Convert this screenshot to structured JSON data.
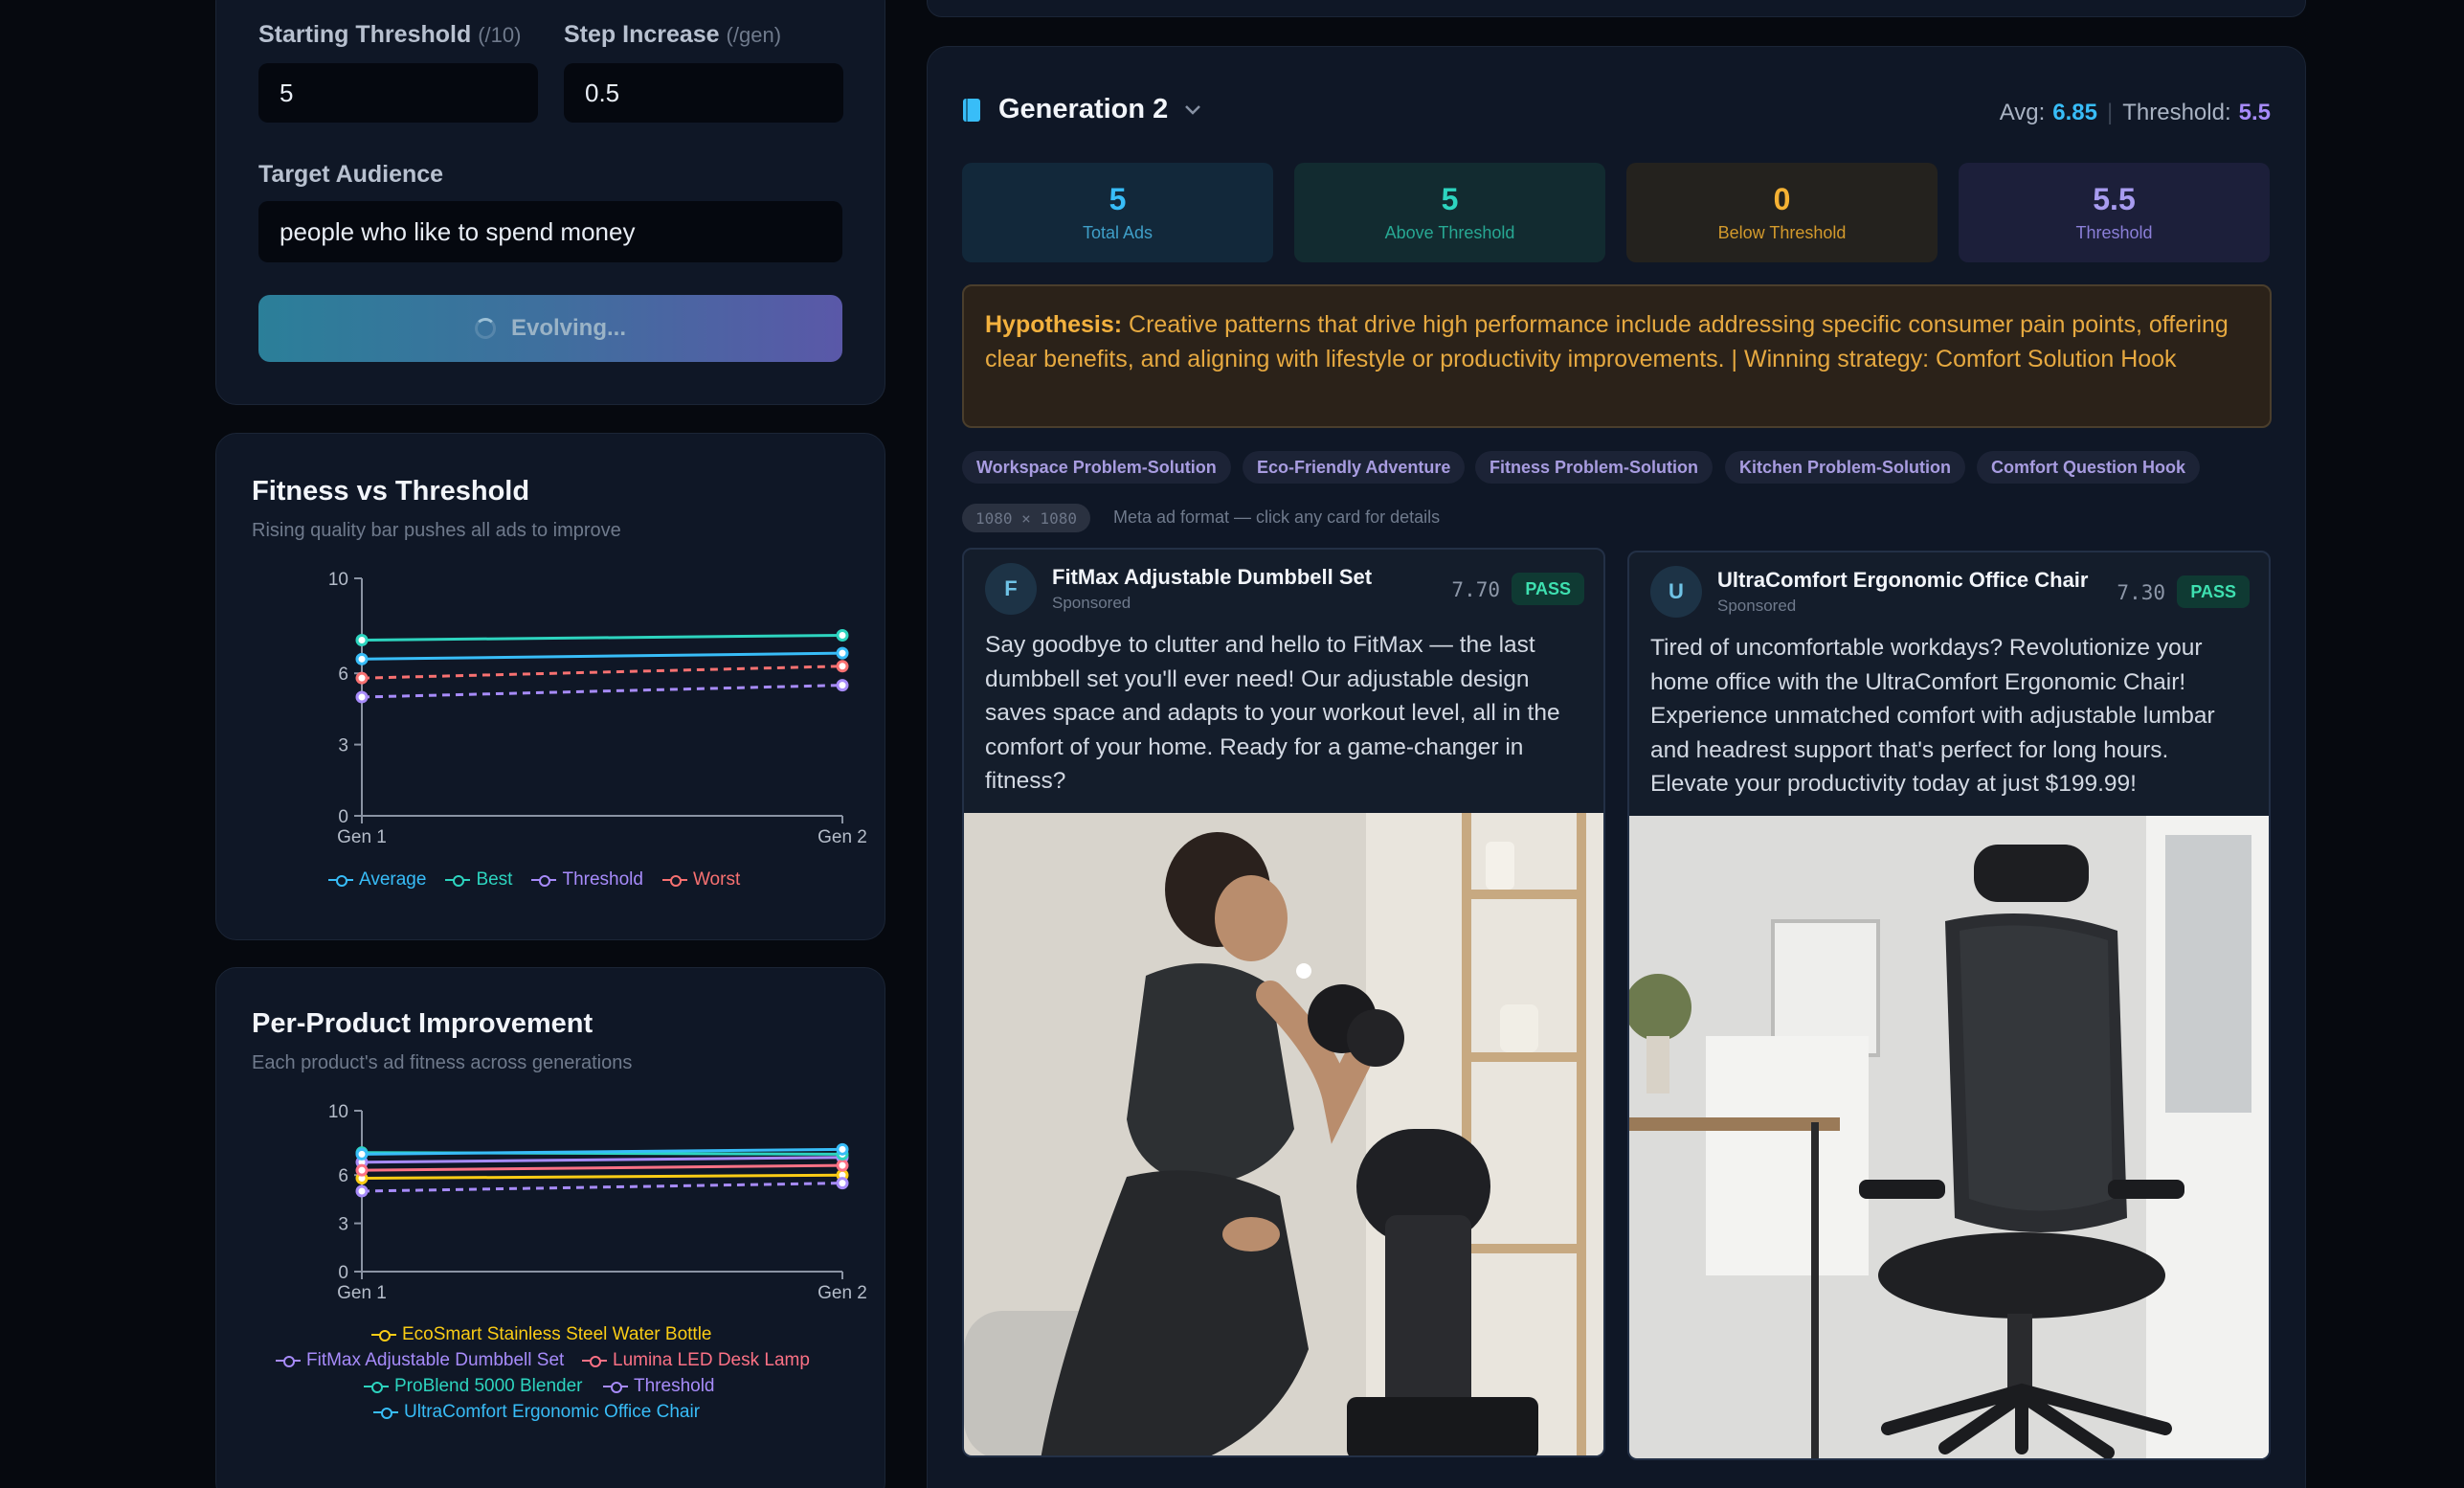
{
  "settings": {
    "starting_threshold_label": "Starting Threshold",
    "starting_threshold_unit": "(/10)",
    "starting_threshold_value": "5",
    "step_increase_label": "Step Increase",
    "step_increase_unit": "(/gen)",
    "step_increase_value": "0.5",
    "target_audience_label": "Target Audience",
    "target_audience_value": "people who like to spend money",
    "evolve_button_label": "Evolving..."
  },
  "fitness_chart": {
    "title": "Fitness vs Threshold",
    "subtitle": "Rising quality bar pushes all ads to improve",
    "legend": [
      "Average",
      "Best",
      "Threshold",
      "Worst"
    ]
  },
  "product_chart": {
    "title": "Per-Product Improvement",
    "subtitle": "Each product's ad fitness across generations",
    "legend": [
      "EcoSmart Stainless Steel Water Bottle",
      "FitMax Adjustable Dumbbell Set",
      "Lumina LED Desk Lamp",
      "ProBlend 5000 Blender",
      "Threshold",
      "UltraComfort Ergonomic Office Chair"
    ]
  },
  "chart_data": [
    {
      "type": "line",
      "title": "Fitness vs Threshold",
      "subtitle": "Rising quality bar pushes all ads to improve",
      "categories": [
        "Gen 1",
        "Gen 2"
      ],
      "yticks": [
        0,
        3,
        6,
        10
      ],
      "ylim": [
        0,
        10
      ],
      "grid": false,
      "legend_position": "bottom",
      "series": [
        {
          "name": "Average",
          "values": [
            6.6,
            6.85
          ],
          "color": "#38bdf8",
          "dashed": false
        },
        {
          "name": "Best",
          "values": [
            7.4,
            7.6
          ],
          "color": "#2dd4bf",
          "dashed": false
        },
        {
          "name": "Threshold",
          "values": [
            5.0,
            5.5
          ],
          "color": "#a78bfa",
          "dashed": true
        },
        {
          "name": "Worst",
          "values": [
            5.8,
            6.3
          ],
          "color": "#f87171",
          "dashed": true
        }
      ]
    },
    {
      "type": "line",
      "title": "Per-Product Improvement",
      "subtitle": "Each product's ad fitness across generations",
      "categories": [
        "Gen 1",
        "Gen 2"
      ],
      "yticks": [
        0,
        3,
        6,
        10
      ],
      "ylim": [
        0,
        10
      ],
      "grid": false,
      "legend_position": "bottom",
      "series": [
        {
          "name": "EcoSmart Stainless Steel Water Bottle",
          "values": [
            5.8,
            6.0
          ],
          "color": "#facc15",
          "dashed": false
        },
        {
          "name": "FitMax Adjustable Dumbbell Set",
          "values": [
            6.8,
            7.1
          ],
          "color": "#a78bfa",
          "dashed": false
        },
        {
          "name": "Lumina LED Desk Lamp",
          "values": [
            6.3,
            6.6
          ],
          "color": "#fb7185",
          "dashed": false
        },
        {
          "name": "ProBlend 5000 Blender",
          "values": [
            7.4,
            7.3
          ],
          "color": "#2dd4bf",
          "dashed": false
        },
        {
          "name": "Threshold",
          "values": [
            5.0,
            5.5
          ],
          "color": "#a78bfa",
          "dashed": true
        },
        {
          "name": "UltraComfort Ergonomic Office Chair",
          "values": [
            7.3,
            7.6
          ],
          "color": "#38bdf8",
          "dashed": false
        }
      ]
    }
  ],
  "generation": {
    "title": "Generation 2",
    "avg_label": "Avg:",
    "avg_value": "6.85",
    "threshold_label": "Threshold:",
    "threshold_value": "5.5",
    "stats": [
      {
        "value": "5",
        "label": "Total Ads"
      },
      {
        "value": "5",
        "label": "Above Threshold"
      },
      {
        "value": "0",
        "label": "Below Threshold"
      },
      {
        "value": "5.5",
        "label": "Threshold"
      }
    ],
    "hypothesis_label": "Hypothesis:",
    "hypothesis_text": "Creative patterns that drive high performance include addressing specific consumer pain points, offering clear benefits, and aligning with lifestyle or productivity improvements. | Winning strategy: Comfort Solution Hook",
    "chips": [
      "Workspace Problem-Solution",
      "Eco-Friendly Adventure",
      "Fitness Problem-Solution",
      "Kitchen Problem-Solution",
      "Comfort Question Hook"
    ],
    "format_badge": "1080 × 1080",
    "format_note": "Meta ad format — click any card for details",
    "ads": [
      {
        "avatar": "F",
        "name": "FitMax Adjustable Dumbbell Set",
        "sponsored": "Sponsored",
        "score": "7.70",
        "status": "PASS",
        "copy": "Say goodbye to clutter and hello to FitMax — the last dumbbell set you'll ever need! Our adjustable design saves space and adapts to your workout level, all in the comfort of your home. Ready for a game-changer in fitness?"
      },
      {
        "avatar": "U",
        "name": "UltraComfort Ergonomic Office Chair",
        "sponsored": "Sponsored",
        "score": "7.30",
        "status": "PASS",
        "copy": "Tired of uncomfortable workdays? Revolutionize your home office with the UltraComfort Ergonomic Chair! Experience unmatched comfort with adjustable lumbar and headrest support that's perfect for long hours. Elevate your productivity today at just $199.99!"
      }
    ]
  }
}
